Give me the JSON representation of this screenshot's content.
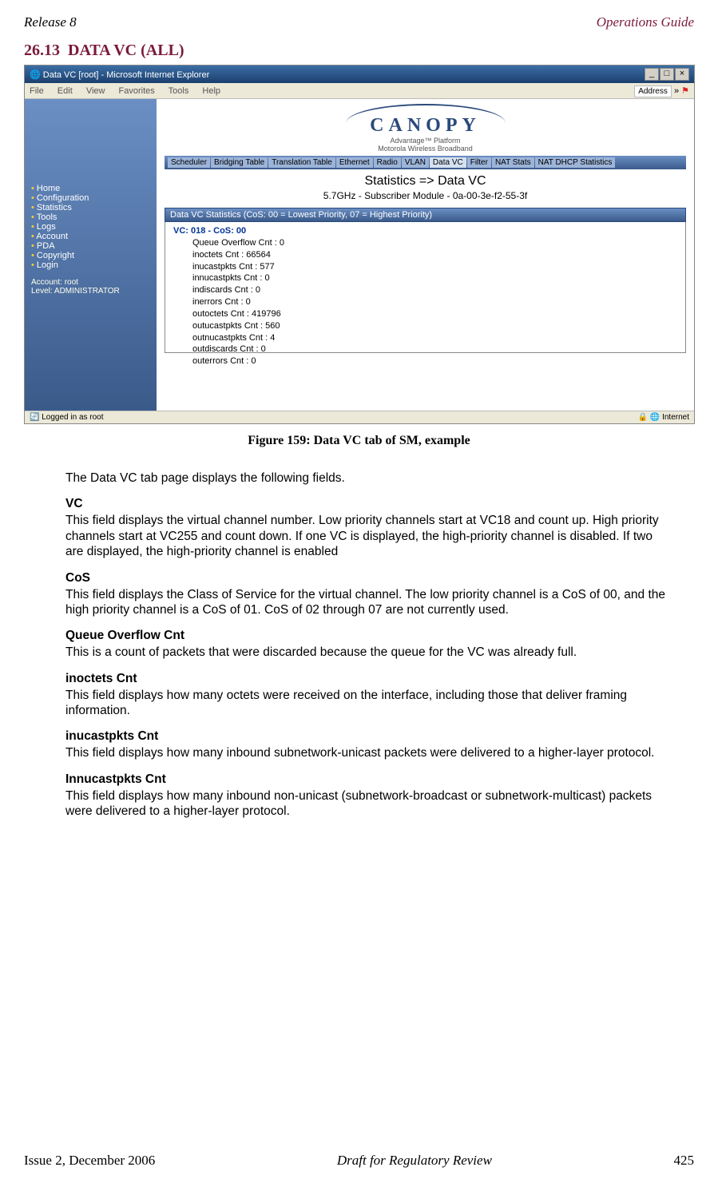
{
  "header": {
    "left": "Release 8",
    "right": "Operations Guide"
  },
  "section": {
    "number": "26.13",
    "title": "DATA VC (ALL)"
  },
  "screenshot": {
    "window_title": "Data VC [root] - Microsoft Internet Explorer",
    "menus": [
      "File",
      "Edit",
      "View",
      "Favorites",
      "Tools",
      "Help"
    ],
    "address_label": "Address",
    "logo": {
      "name": "CANOPY",
      "tagline_top": "Advantage™ Platform",
      "tagline_bottom": "Motorola Wireless Broadband"
    },
    "sidebar_items": [
      "Home",
      "Configuration",
      "Statistics",
      "Tools",
      "Logs",
      "Account",
      "PDA",
      "Copyright",
      "Login"
    ],
    "sidebar_account_line1": "Account: root",
    "sidebar_account_line2": "Level: ADMINISTRATOR",
    "tabs": [
      "Scheduler",
      "Bridging Table",
      "Translation Table",
      "Ethernet",
      "Radio",
      "VLAN",
      "Data VC",
      "Filter",
      "NAT Stats",
      "NAT DHCP Statistics"
    ],
    "active_tab_index": 6,
    "page_subtitle": "Statistics => Data VC",
    "page_subsub": "5.7GHz - Subscriber Module - 0a-00-3e-f2-55-3f",
    "stats_header": "Data VC Statistics (CoS: 00 = Lowest Priority, 07 = Highest Priority)",
    "vc_line": "VC: 018 - CoS: 00",
    "stats": [
      "Queue Overflow Cnt : 0",
      "inoctets Cnt : 66564",
      "inucastpkts Cnt : 577",
      "innucastpkts Cnt : 0",
      "indiscards Cnt : 0",
      "inerrors Cnt : 0",
      "outoctets Cnt : 419796",
      "outucastpkts Cnt : 560",
      "outnucastpkts Cnt : 4",
      "outdiscards Cnt : 0",
      "outerrors Cnt : 0"
    ],
    "status_left": "Logged in as root",
    "status_right": "Internet"
  },
  "caption": "Figure 159: Data VC tab of SM, example",
  "intro": "The Data VC tab page displays the following fields.",
  "fields": [
    {
      "title": "VC",
      "desc": "This field displays the virtual channel number. Low priority channels start at VC18 and count up. High priority channels start at VC255 and count down. If one VC is displayed, the high-priority channel is disabled. If two are displayed, the high-priority channel is enabled"
    },
    {
      "title": "CoS",
      "desc": "This field displays the Class of Service for the virtual channel. The low priority channel is a CoS of 00, and the high priority channel is a CoS of 01. CoS of 02 through 07 are not currently used."
    },
    {
      "title": "Queue Overflow Cnt",
      "desc": "This is a count of packets that  were discarded because the queue for the VC was already full."
    },
    {
      "title": "inoctets Cnt",
      "desc": "This field displays how many octets were received on the interface, including those that deliver framing information."
    },
    {
      "title": "inucastpkts Cnt",
      "desc": "This field displays how many inbound subnetwork-unicast packets were delivered to a higher-layer protocol."
    },
    {
      "title": "Innucastpkts Cnt",
      "desc": "This field displays how many inbound non-unicast (subnetwork-broadcast or subnetwork-multicast) packets were delivered to a higher-layer protocol."
    }
  ],
  "footer": {
    "left": "Issue 2, December 2006",
    "center": "Draft for Regulatory Review",
    "page": "425"
  }
}
